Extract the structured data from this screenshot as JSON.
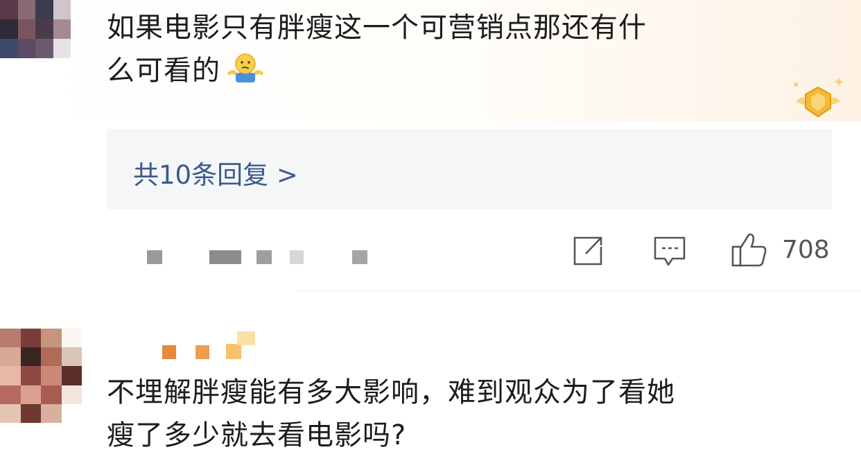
{
  "comments": [
    {
      "text_line1": "如果电影只有胖瘦这一个可营销点那还有什",
      "text_line2": "么可看的",
      "emoji": "shrug-emoji",
      "badge": "gold-fan-badge-icon"
    },
    {
      "text_line1": "不埋解胖瘦能有多大影响，难到观众为了看她",
      "text_line2": "瘦了多少就去看电影吗?"
    }
  ],
  "replies": {
    "label": "共10条回复 >"
  },
  "actions": {
    "share_icon": "share-icon",
    "comment_icon": "comment-icon",
    "like_icon": "thumbs-up-icon",
    "like_count": "708"
  },
  "colors": {
    "link": "#3b5a8c",
    "reply_bg": "#f5f6f8",
    "icon_gray": "#555555",
    "badge_gold": "#f3b93a"
  }
}
